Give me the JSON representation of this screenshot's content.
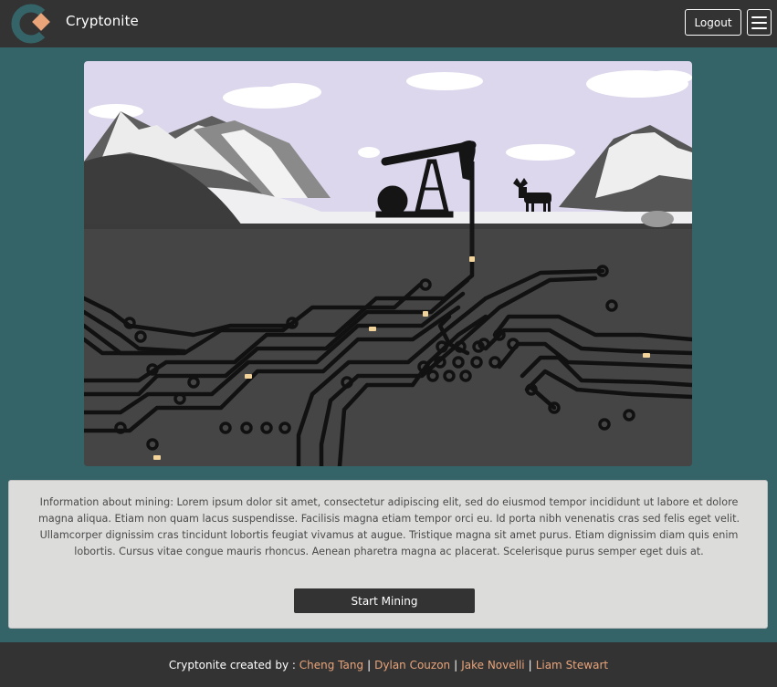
{
  "nav": {
    "brand": "Cryptonite",
    "logout_label": "Logout",
    "colors": {
      "navbar": "#333333",
      "logo_ring": "#346468",
      "logo_diamond": "#e9a47a"
    }
  },
  "hero": {
    "icon": "oil-pump-circuit-illustration"
  },
  "info": {
    "text": "Information about mining: Lorem ipsum dolor sit amet, consectetur adipiscing elit, sed do eiusmod tempor incididunt ut labore et dolore magna aliqua. Etiam non quam lacus suspendisse. Facilisis magna etiam tempor orci eu. Id porta nibh venenatis cras sed felis eget velit. Ullamcorper dignissim cras tincidunt lobortis feugiat vivamus at augue. Tristique magna sit amet purus. Etiam dignissim diam quis enim lobortis. Cursus vitae congue mauris rhoncus. Aenean pharetra magna ac placerat. Scelerisque purus semper eget duis at.",
    "button_label": "Start Mining"
  },
  "footer": {
    "prefix": "Cryptonite created by : ",
    "authors": [
      "Cheng Tang",
      "Dylan Couzon",
      "Jake Novelli",
      "Liam Stewart"
    ],
    "separator": "|",
    "colors": {
      "link": "#e9a47a"
    }
  },
  "colors": {
    "page_background": "#346468",
    "card_background": "#dcdcdb"
  }
}
